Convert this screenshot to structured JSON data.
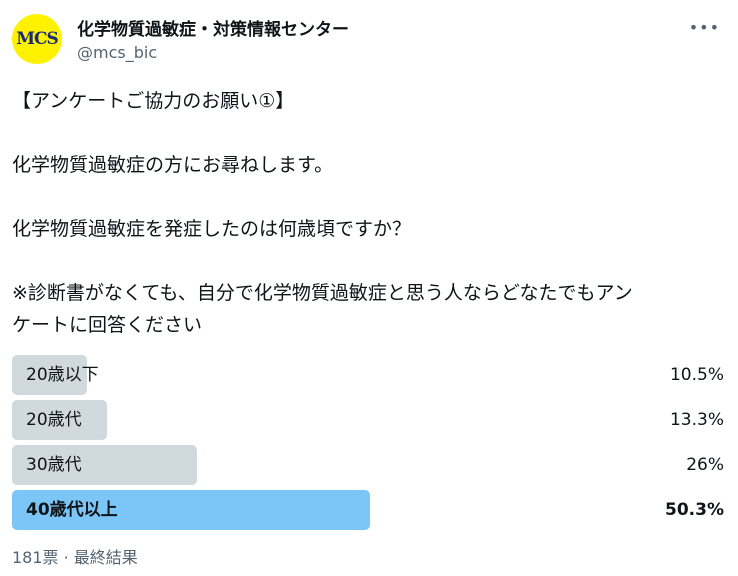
{
  "tweet": {
    "avatar_text": "MCS",
    "display_name": "化学物質過敏症・対策情報センター",
    "handle": "@mcs_bic",
    "more_label": "•••",
    "text": "【アンケートご協力のお願い①】\n\n化学物質過敏症の方にお尋ねします。\n\n化学物質過敏症を発症したのは何歳頃ですか？\n\n※診断書がなくても、自分で化学物質過敏症と思う人ならどなたでもアン\nケートに回答ください"
  },
  "poll": {
    "options": [
      {
        "label": "20歳以下",
        "percent_text": "10.5%",
        "percent": 10.5
      },
      {
        "label": "20歳代",
        "percent_text": "13.3%",
        "percent": 13.3
      },
      {
        "label": "30歳代",
        "percent_text": "26%",
        "percent": 26
      },
      {
        "label": "40歳代以上",
        "percent_text": "50.3%",
        "percent": 50.3,
        "winner": true
      }
    ],
    "summary": "181票 · 最終結果"
  },
  "colors": {
    "bar": "#cfd9de",
    "winner_bar": "#7cc6f7",
    "avatar_bg": "#fff200",
    "avatar_text": "#1a2a7a",
    "muted_text": "#536471"
  }
}
